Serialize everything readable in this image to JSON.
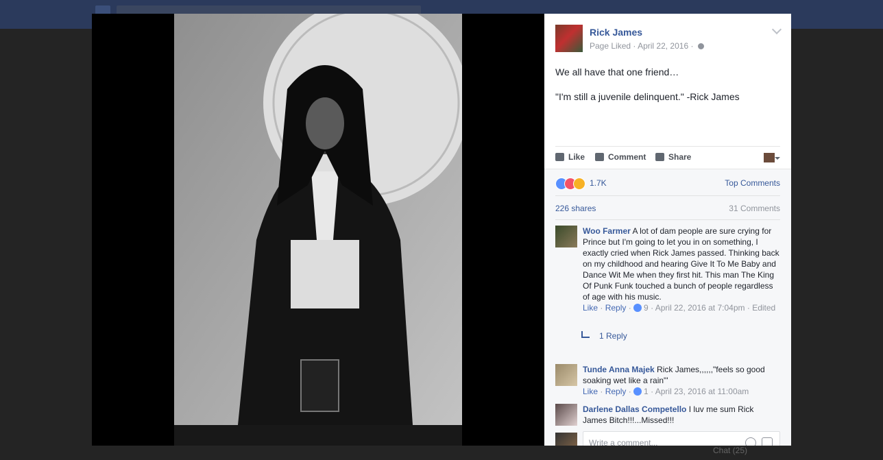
{
  "post": {
    "page_name": "Rick James",
    "meta_liked": "Page Liked",
    "meta_sep": " · ",
    "meta_date": "April 22, 2016",
    "meta_sep2": " · ",
    "text_line1": "We all have that one friend…",
    "text_line2": "\"I'm still a juvenile delinquent.\" -Rick James"
  },
  "actions": {
    "like": "Like",
    "comment": "Comment",
    "share": "Share"
  },
  "ufi": {
    "reaction_count": "1.7K",
    "top_comments": "Top Comments",
    "shares": "226 shares",
    "comments_count": "31 Comments"
  },
  "comments": [
    {
      "name": "Woo Farmer",
      "text": "A lot of dam people are sure crying for Prince but I'm going to let you in on something, I exactly cried when Rick James passed. Thinking back on my childhood and hearing Give It To Me Baby and Dance Wit Me when they first hit. This man The King Of Punk Funk touched a bunch of people regardless of age with his music.",
      "like": "Like",
      "reply": "Reply",
      "likes": "9",
      "time": "April 22, 2016 at 7:04pm",
      "edited": "Edited",
      "replies": "1 Reply"
    },
    {
      "name": "Tunde Anna Majek",
      "text": "Rick James,,,,,,\"feels so good soaking wet like a rain\"'",
      "like": "Like",
      "reply": "Reply",
      "likes": "1",
      "time": "April 23, 2016 at 11:00am"
    },
    {
      "name": "Darlene Dallas Competello",
      "text": "I luv me sum Rick James Bitch!!!...Missed!!!"
    }
  ],
  "composer": {
    "placeholder": "Write a comment..."
  },
  "background": {
    "chat": "Chat (25)"
  },
  "colors": {
    "link": "#365899",
    "muted": "#90949c",
    "like_blue": "#5890ff",
    "love_red": "#f25268",
    "haha_yellow": "#f7b125"
  }
}
